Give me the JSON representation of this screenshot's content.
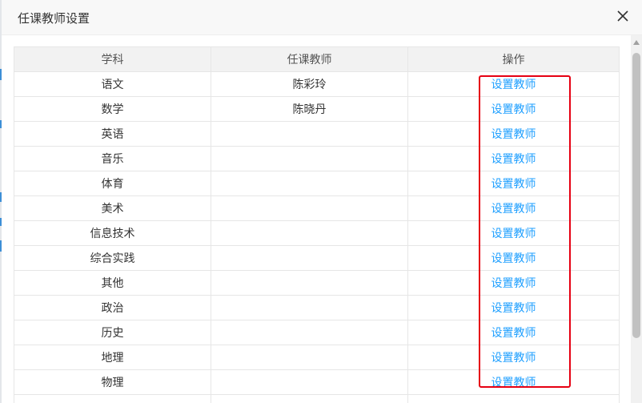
{
  "dialog": {
    "title": "任课教师设置",
    "close_icon": "close-icon"
  },
  "table": {
    "headers": [
      "学科",
      "任课教师",
      "操作"
    ],
    "action_label": "设置教师",
    "rows": [
      {
        "subject": "语文",
        "teacher": "陈彩玲"
      },
      {
        "subject": "数学",
        "teacher": "陈晓丹"
      },
      {
        "subject": "英语",
        "teacher": ""
      },
      {
        "subject": "音乐",
        "teacher": ""
      },
      {
        "subject": "体育",
        "teacher": ""
      },
      {
        "subject": "美术",
        "teacher": ""
      },
      {
        "subject": "信息技术",
        "teacher": ""
      },
      {
        "subject": "综合实践",
        "teacher": ""
      },
      {
        "subject": "其他",
        "teacher": ""
      },
      {
        "subject": "政治",
        "teacher": ""
      },
      {
        "subject": "历史",
        "teacher": ""
      },
      {
        "subject": "地理",
        "teacher": ""
      },
      {
        "subject": "物理",
        "teacher": ""
      },
      {
        "subject": "",
        "teacher": ""
      }
    ]
  },
  "colors": {
    "link": "#1e9fff",
    "highlight": "#e60012",
    "header_bg": "#f2f2f2",
    "border": "#e6e6e6"
  }
}
